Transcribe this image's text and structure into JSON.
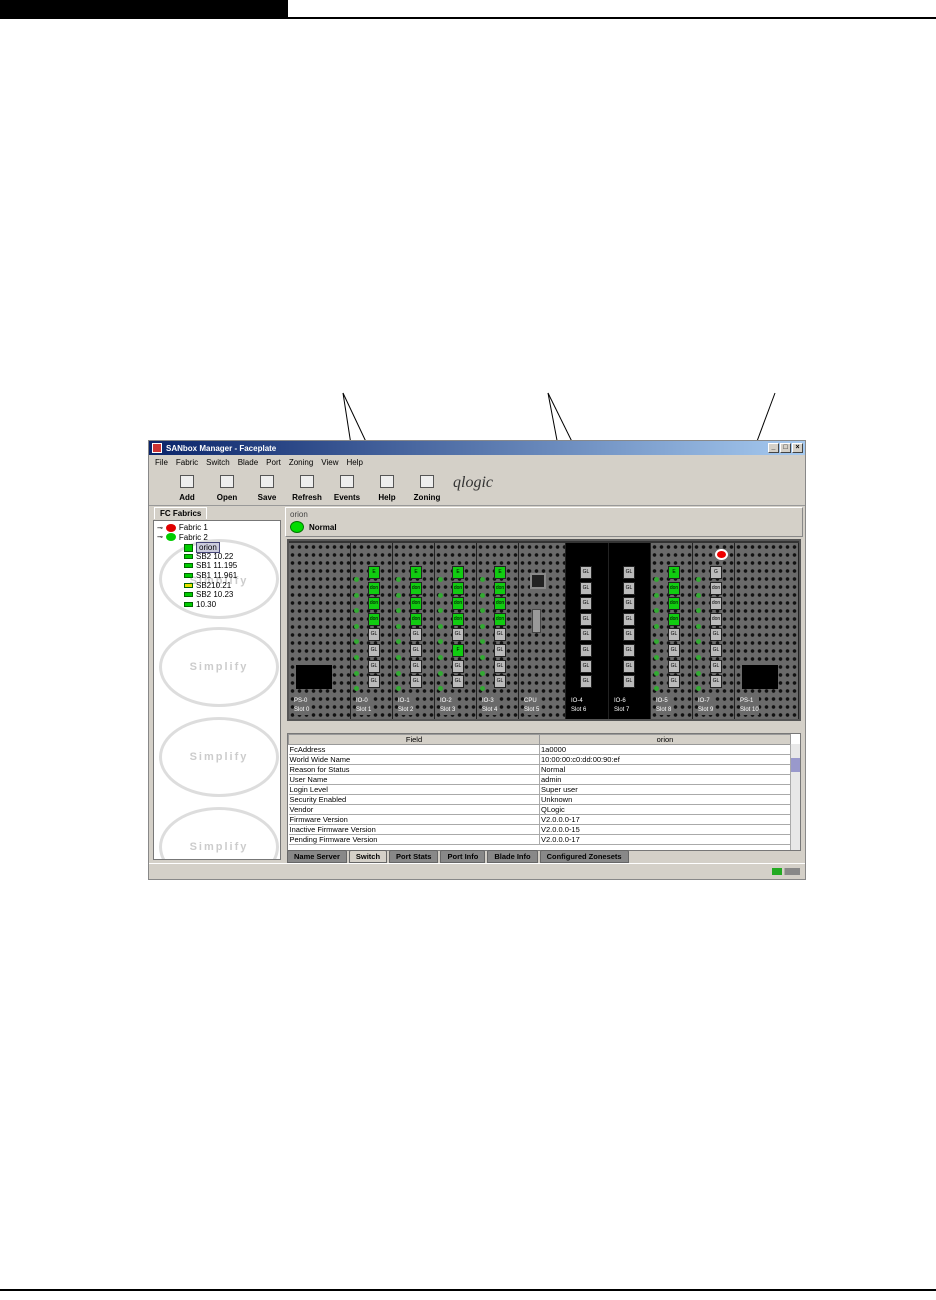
{
  "window": {
    "title": "SANbox Manager - Faceplate",
    "controls": [
      "_",
      "□",
      "×"
    ]
  },
  "menu": [
    "File",
    "Fabric",
    "Switch",
    "Blade",
    "Port",
    "Zoning",
    "View",
    "Help"
  ],
  "toolbar": [
    {
      "label": "Add",
      "icon": "add-icon"
    },
    {
      "label": "Open",
      "icon": "open-icon"
    },
    {
      "label": "Save",
      "icon": "save-icon"
    },
    {
      "label": "Refresh",
      "icon": "refresh-icon"
    },
    {
      "label": "Events",
      "icon": "events-icon"
    },
    {
      "label": "Help",
      "icon": "help-icon"
    },
    {
      "label": "Zoning",
      "icon": "zoning-icon"
    }
  ],
  "brand": "qlogic",
  "left": {
    "tab": "FC Fabrics",
    "watermark": "Simplify",
    "tree": [
      {
        "label": "Fabric 1",
        "level": 0,
        "color": "#e00000"
      },
      {
        "label": "Fabric 2",
        "level": 0,
        "color": "#00cc00"
      },
      {
        "label": "orion",
        "level": 1,
        "selected": true
      },
      {
        "label": "SB2 10.22",
        "level": 1
      },
      {
        "label": "SB1 11.195",
        "level": 1
      },
      {
        "label": "SB1 11.961",
        "level": 1
      },
      {
        "label": "SB210.21",
        "level": 1,
        "color": "#e8e000"
      },
      {
        "label": "SB2 10.23",
        "level": 1
      },
      {
        "label": "10.30",
        "level": 1
      }
    ]
  },
  "switch": {
    "name": "orion",
    "status": "Normal",
    "status_color": "#00dd00"
  },
  "slots": [
    {
      "name": "PS-0",
      "slot": "Slot 0",
      "type": "ps"
    },
    {
      "name": "IO-0",
      "slot": "Slot 1",
      "ports": [
        "E",
        "don",
        "don",
        "don",
        "GL",
        "GL",
        "GL",
        "GL"
      ]
    },
    {
      "name": "IO-1",
      "slot": "Slot 2",
      "ports": [
        "E",
        "don",
        "don",
        "don",
        "GL",
        "GL",
        "GL",
        "GL"
      ]
    },
    {
      "name": "IO-2",
      "slot": "Slot 3",
      "ports": [
        "E",
        "don",
        "don",
        "don",
        "GL",
        "F",
        "GL",
        "GL"
      ]
    },
    {
      "name": "IO-3",
      "slot": "Slot 4",
      "ports": [
        "E",
        "don",
        "don",
        "don",
        "GL",
        "GL",
        "GL",
        "GL"
      ]
    },
    {
      "name": "CPU",
      "slot": "Slot 5",
      "type": "cpu"
    },
    {
      "name": "IO-4",
      "slot": "Slot 6",
      "black": true,
      "ports": [
        "GL",
        "GL",
        "GL",
        "GL",
        "GL",
        "GL",
        "GL",
        "GL"
      ]
    },
    {
      "name": "IO-6",
      "slot": "Slot 7",
      "black": true,
      "ports": [
        "GL",
        "GL",
        "GL",
        "GL",
        "GL",
        "GL",
        "GL",
        "GL"
      ]
    },
    {
      "name": "IO-5",
      "slot": "Slot 8",
      "ports": [
        "E",
        "don",
        "don",
        "don",
        "GL",
        "GL",
        "GL",
        "GL"
      ]
    },
    {
      "name": "IO-7",
      "slot": "Slot 9",
      "fault": true,
      "ports": [
        "G",
        "don",
        "don",
        "don",
        "GL",
        "GL",
        "GL",
        "GL"
      ]
    },
    {
      "name": "PS-1",
      "slot": "Slot 10",
      "type": "ps"
    }
  ],
  "table": {
    "headers": [
      "Field",
      "orion"
    ],
    "rows": [
      [
        "FcAddress",
        "1a0000"
      ],
      [
        "World Wide Name",
        "10:00:00:c0:dd:00:90:ef"
      ],
      [
        "Reason for Status",
        "Normal"
      ],
      [
        "User Name",
        "admin"
      ],
      [
        "Login Level",
        "Super user"
      ],
      [
        "Security Enabled",
        "Unknown"
      ],
      [
        "Vendor",
        "QLogic"
      ],
      [
        "Firmware Version",
        "V2.0.0.0-17"
      ],
      [
        "Inactive Firmware Version",
        "V2.0.0.0-15"
      ],
      [
        "Pending Firmware Version",
        "V2.0.0.0-17"
      ]
    ]
  },
  "tabs": [
    {
      "label": "Name Server"
    },
    {
      "label": "Switch",
      "active": true
    },
    {
      "label": "Port Stats"
    },
    {
      "label": "Port Info"
    },
    {
      "label": "Blade Info"
    },
    {
      "label": "Configured Zonesets"
    }
  ]
}
